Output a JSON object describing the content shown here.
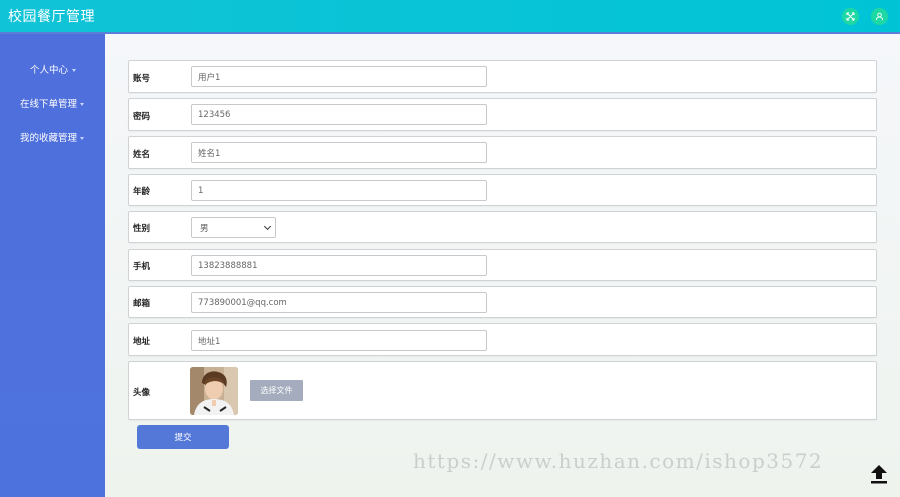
{
  "app": {
    "title": "校园餐厅管理"
  },
  "header_icons": {
    "fullscreen": "fullscreen-icon",
    "user": "user-icon"
  },
  "colors": {
    "topbar": "#00c4d6",
    "sidebar": "#4f6fdc",
    "header_icon_bg": "#1ed8a3",
    "submit": "#5478d8",
    "file_button": "#a4acbd"
  },
  "sidebar": {
    "items": [
      {
        "label": "个人中心"
      },
      {
        "label": "在线下单管理"
      },
      {
        "label": "我的收藏管理"
      }
    ]
  },
  "form": {
    "account": {
      "label": "账号",
      "value": "用户1"
    },
    "password": {
      "label": "密码",
      "value": "123456"
    },
    "name": {
      "label": "姓名",
      "value": "姓名1"
    },
    "age": {
      "label": "年龄",
      "value": "1"
    },
    "gender": {
      "label": "性别",
      "value": "男"
    },
    "phone": {
      "label": "手机",
      "value": "13823888881"
    },
    "email": {
      "label": "邮箱",
      "value": "773890001@qq.com"
    },
    "address": {
      "label": "地址",
      "value": "地址1"
    },
    "avatar": {
      "label": "头像",
      "file_button": "选择文件"
    },
    "submit_label": "提交"
  },
  "watermark": "https://www.huzhan.com/ishop3572"
}
